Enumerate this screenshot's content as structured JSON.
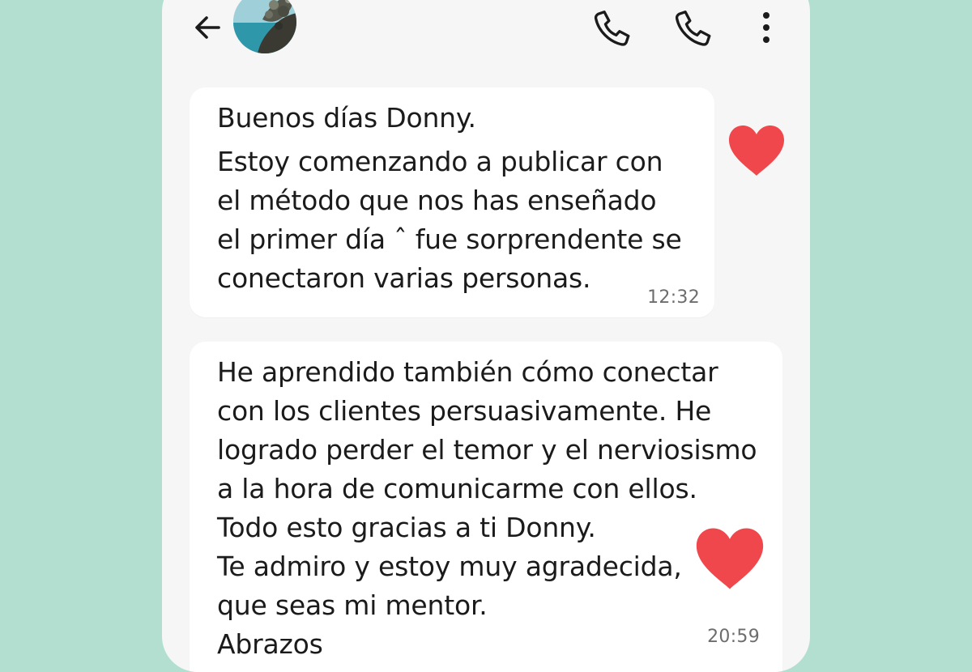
{
  "header": {
    "back_icon": "arrow-left-icon",
    "avatar_icon": "contact-avatar",
    "voice_call_icon": "phone-icon",
    "second_call_icon": "phone-icon",
    "menu_icon": "more-vert-icon"
  },
  "messages": [
    {
      "lines": [
        "Buenos días Donny.",
        "Estoy comenzando a publicar con",
        "el método que nos has enseñado",
        "el primer día ˆ fue sorprendente se",
        "conectaron varias personas."
      ],
      "time": "12:32",
      "reaction": "heart-icon"
    },
    {
      "lines": [
        "He aprendido también cómo conectar",
        "con los clientes persuasivamente. He",
        "logrado perder el temor y el nerviosismo",
        "a la hora de comunicarme con ellos.",
        "Todo esto gracias a ti Donny.",
        "Te admiro y estoy muy agradecida,",
        "que seas mi mentor.",
        "Abrazos"
      ],
      "time": "20:59",
      "reaction": "heart-icon"
    }
  ],
  "colors": {
    "background": "#b2dfd0",
    "panel": "#f6f6f6",
    "bubble": "#ffffff",
    "heart": "#f0474d",
    "text": "#1b1b1b",
    "timestamp": "#6d6d6d"
  }
}
